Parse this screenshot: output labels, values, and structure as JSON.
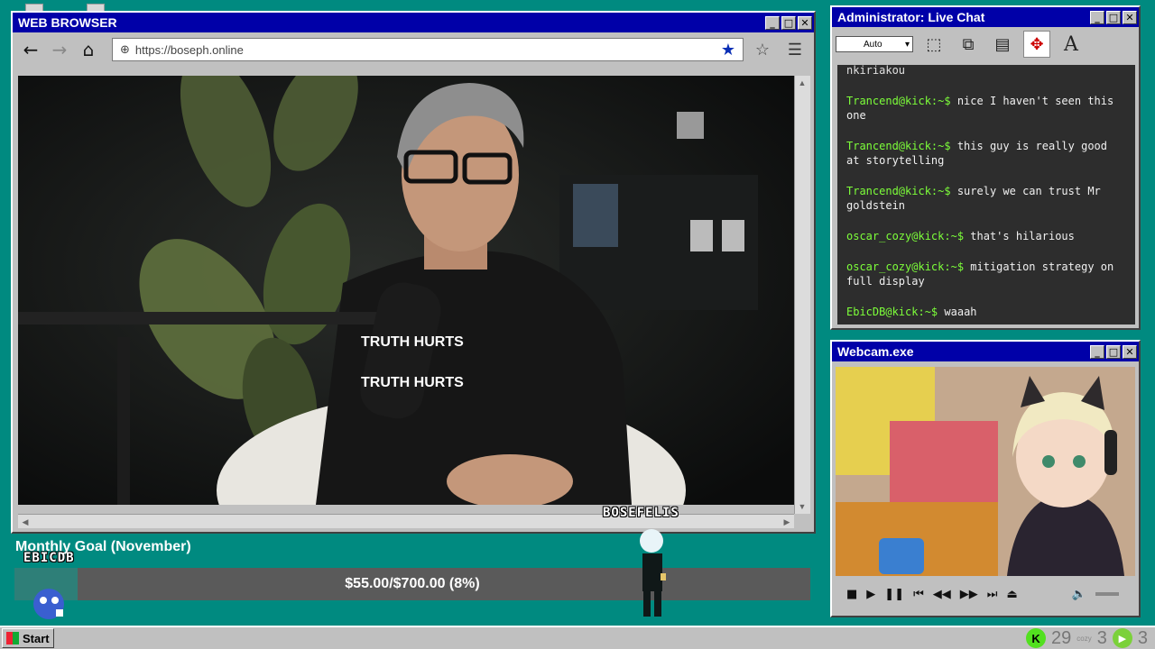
{
  "browser": {
    "title": "WEB BROWSER",
    "url": "https://boseph.online",
    "video_caption_top": "TRUTH HURTS",
    "video_caption_bottom": "TRUTH HURTS"
  },
  "chat": {
    "title": "Administrator: Live Chat",
    "select_value": "Auto",
    "partial_line": "nkiriakou",
    "messages": [
      {
        "user": "Trancend@kick:~$",
        "text": "nice I haven't seen this one"
      },
      {
        "user": "Trancend@kick:~$",
        "text": "this guy is really good at storytelling"
      },
      {
        "user": "Trancend@kick:~$",
        "text": "surely we can trust Mr goldstein"
      },
      {
        "user": "oscar_cozy@kick:~$",
        "text": "that's hilarious"
      },
      {
        "user": "oscar_cozy@kick:~$",
        "text": "mitigation strategy on full display"
      },
      {
        "user": "EbicDB@kick:~$",
        "text": "waaah"
      }
    ]
  },
  "webcam": {
    "title": "Webcam.exe"
  },
  "goal": {
    "title": "Monthly Goal (November)",
    "text": "$55.00/$700.00 (8%)",
    "progress_fraction": 0.079
  },
  "avatars": {
    "left_name": "EBICDB",
    "right_name": "BOSEFELIS"
  },
  "taskbar": {
    "start_label": "Start",
    "tray_k_count": "29",
    "tray_cozy_label": "cozy",
    "tray_cozy_count": "3",
    "tray_p_count": "3"
  }
}
